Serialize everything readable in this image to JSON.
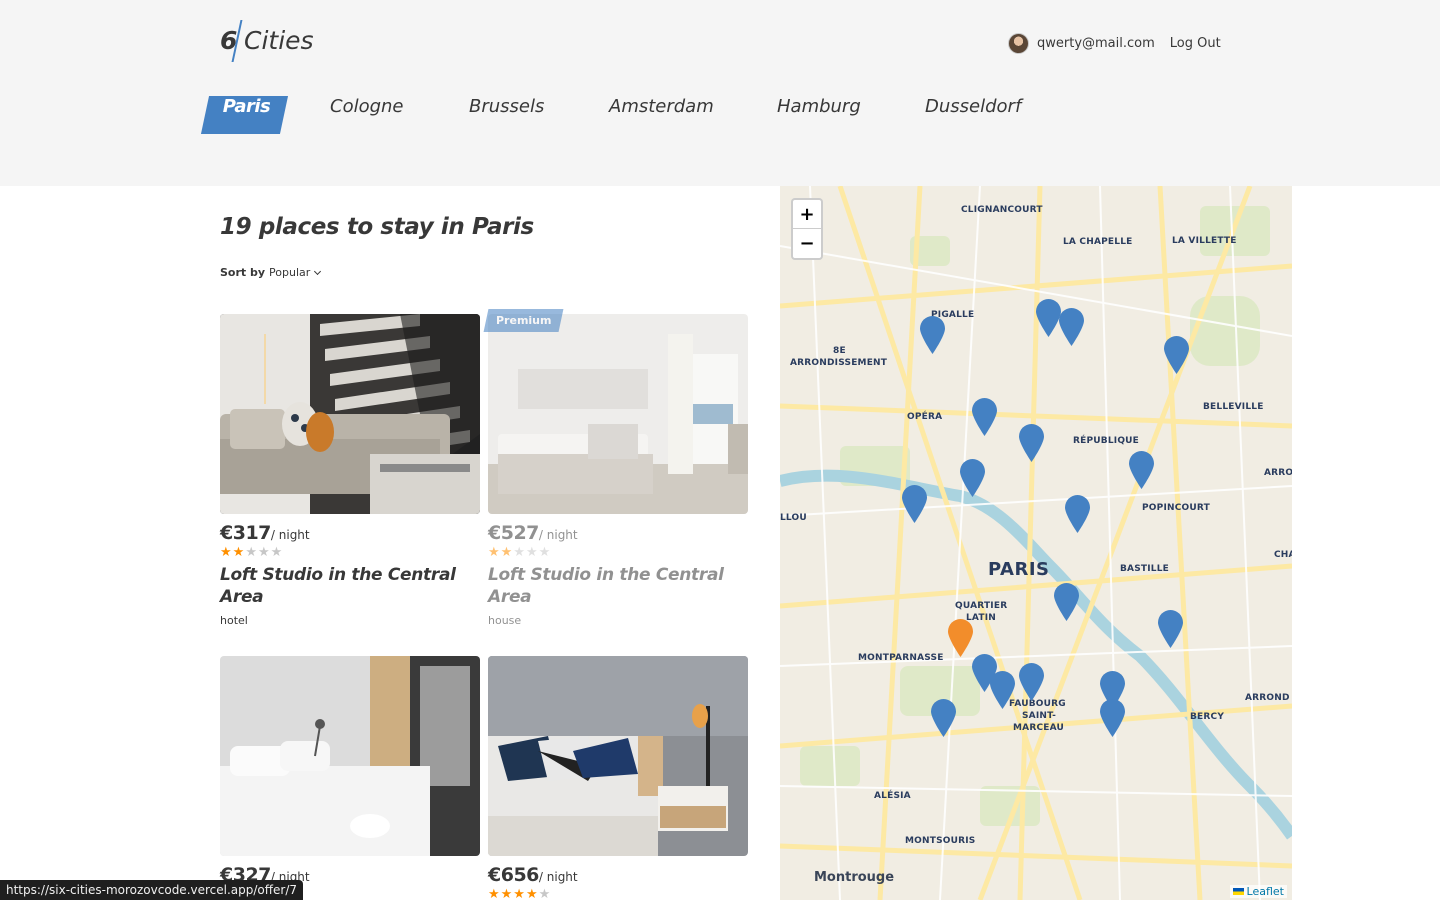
{
  "header": {
    "logo_number": "6",
    "logo_text": "Cities",
    "user_email": "qwerty@mail.com",
    "logout_label": "Log Out"
  },
  "tabs": [
    {
      "label": "Paris",
      "active": true
    },
    {
      "label": "Cologne",
      "active": false
    },
    {
      "label": "Brussels",
      "active": false
    },
    {
      "label": "Amsterdam",
      "active": false
    },
    {
      "label": "Hamburg",
      "active": false
    },
    {
      "label": "Dusseldorf",
      "active": false
    }
  ],
  "main": {
    "title": "19 places to stay in Paris",
    "sort_label": "Sort by",
    "sort_value": "Popular"
  },
  "offers": [
    {
      "price": "€317",
      "per": "/ night",
      "rating": 2,
      "name": "Loft Studio in the Central Area",
      "type": "hotel",
      "premium": false
    },
    {
      "price": "€527",
      "per": "/ night",
      "rating": 2,
      "name": "Loft Studio in the Central Area",
      "type": "house",
      "premium": true,
      "premium_label": "Premium"
    },
    {
      "price": "€327",
      "per": "/ night",
      "rating": 0,
      "name": "",
      "type": "",
      "premium": false
    },
    {
      "price": "€656",
      "per": "/ night",
      "rating": 4,
      "name": "",
      "type": "",
      "premium": false
    }
  ],
  "map": {
    "zoom_in": "+",
    "zoom_out": "−",
    "attribution": "Leaflet",
    "labels": {
      "clignancourt": "CLIGNANCOURT",
      "la_chapelle": "LA CHAPELLE",
      "la_villette": "LA VILLETTE",
      "pigalle": "PIGALLE",
      "arr8_a": "8E",
      "arr8_b": "ARRONDISSEMENT",
      "opera": "OPÉRA",
      "republique": "RÉPUBLIQUE",
      "belleville": "BELLEVILLE",
      "popincourt": "POPINCOURT",
      "paris": "PARIS",
      "bastille": "BASTILLE",
      "quartier_a": "QUARTIER",
      "quartier_b": "LATIN",
      "montparnasse": "MONTPARNASSE",
      "faubourg_a": "FAUBOURG",
      "faubourg_b": "SAINT-",
      "faubourg_c": "MARCEAU",
      "bercy": "BERCY",
      "alesia": "ALÉSIA",
      "montsouris": "MONTSOURIS",
      "montrouge": "Montrouge",
      "arro_top": "ARRO",
      "cha": "CHA",
      "arrond_bottom": "ARROND",
      "llou": "LLOU"
    },
    "pin_color": "#4481c3",
    "active_pin_color": "#f28d2b"
  },
  "status_url": "https://six-cities-morozovcode.vercel.app/offer/7",
  "colors": {
    "accent": "#4481c3",
    "star": "#ff9000",
    "header_bg": "#f5f5f5"
  }
}
